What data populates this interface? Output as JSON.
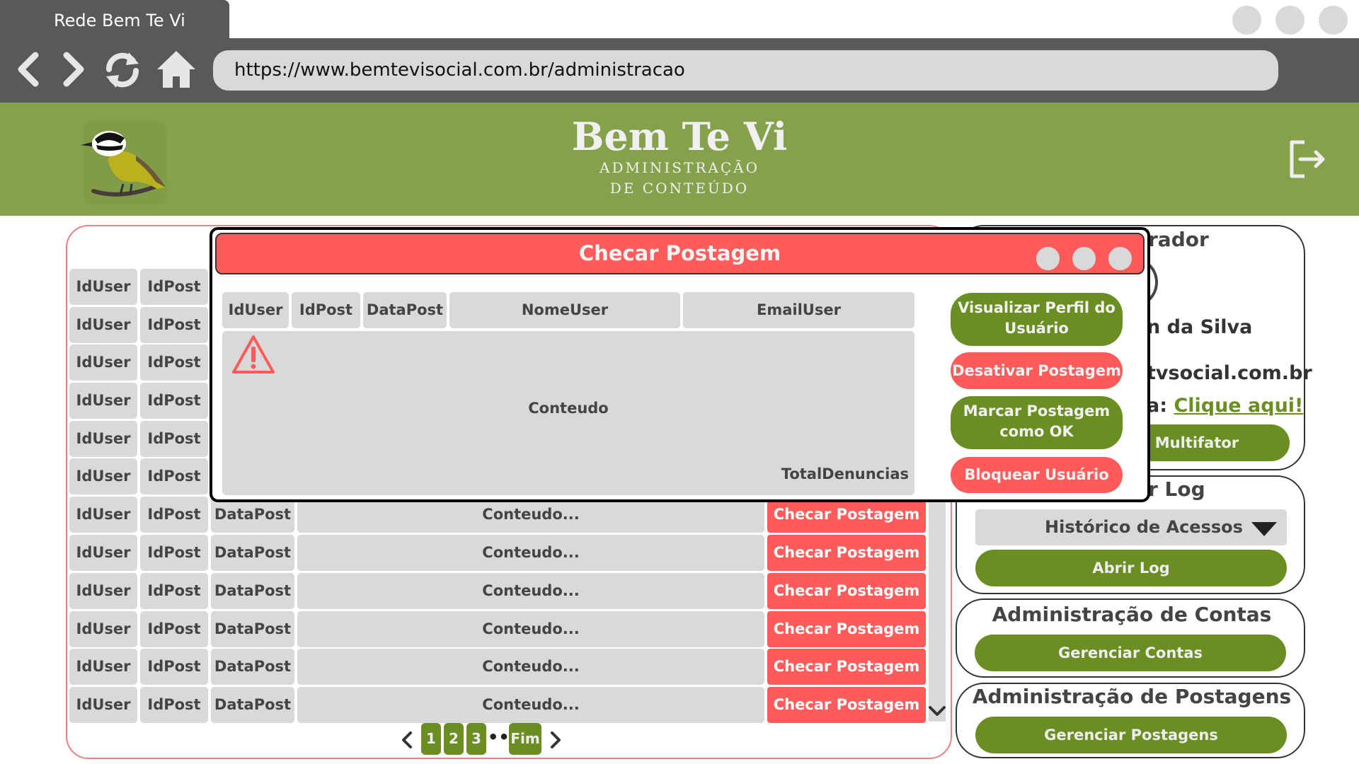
{
  "browser": {
    "tab_title": "Rede Bem Te Vi",
    "url": "https://www.bemtevisocial.com.br/administracao"
  },
  "banner": {
    "brand_name": "Bem Te Vi",
    "brand_subtitle": "ADMINISTRAÇÃO DE CONTEÚDO"
  },
  "table": {
    "rows": [
      {
        "iduser": "IdUser",
        "idpost": "IdPost"
      },
      {
        "iduser": "IdUser",
        "idpost": "IdPost"
      },
      {
        "iduser": "IdUser",
        "idpost": "IdPost"
      },
      {
        "iduser": "IdUser",
        "idpost": "IdPost"
      },
      {
        "iduser": "IdUser",
        "idpost": "IdPost"
      },
      {
        "iduser": "IdUser",
        "idpost": "IdPost"
      },
      {
        "iduser": "IdUser",
        "idpost": "IdPost",
        "datapost": "DataPost",
        "content": "Conteudo...",
        "action": "Checar Postagem"
      },
      {
        "iduser": "IdUser",
        "idpost": "IdPost",
        "datapost": "DataPost",
        "content": "Conteudo...",
        "action": "Checar Postagem"
      },
      {
        "iduser": "IdUser",
        "idpost": "IdPost",
        "datapost": "DataPost",
        "content": "Conteudo...",
        "action": "Checar Postagem"
      },
      {
        "iduser": "IdUser",
        "idpost": "IdPost",
        "datapost": "DataPost",
        "content": "Conteudo...",
        "action": "Checar Postagem"
      },
      {
        "iduser": "IdUser",
        "idpost": "IdPost",
        "datapost": "DataPost",
        "content": "Conteudo...",
        "action": "Checar Postagem"
      },
      {
        "iduser": "IdUser",
        "idpost": "IdPost",
        "datapost": "DataPost",
        "content": "Conteudo...",
        "action": "Checar Postagem"
      }
    ]
  },
  "pagination": {
    "pages": [
      "1",
      "2",
      "3"
    ],
    "ellipsis": "•••",
    "last": "Fim"
  },
  "admin_panel": {
    "title_fragment": "rador",
    "name_fragment": "n da Silva",
    "email_fragment": "tvsocial.com.br",
    "password_prefix": "a:",
    "password_link": "Clique aqui!",
    "mfa_button": "ão Multifator"
  },
  "log_panel": {
    "title_fragment": "r Log",
    "select_value": "Histórico de Acessos",
    "open_button": "Abrir Log"
  },
  "accounts_panel": {
    "title": "Administração de Contas",
    "button": "Gerenciar Contas"
  },
  "posts_panel": {
    "title": "Administração de Postagens",
    "button": "Gerenciar Postagens"
  },
  "modal": {
    "title": "Checar Postagem",
    "headers": [
      "IdUser",
      "IdPost",
      "DataPost",
      "NomeUser",
      "EmailUser"
    ],
    "content_label": "Conteudo",
    "total_label": "TotalDenuncias",
    "buttons": {
      "view_profile": "Visualizar Perfil do Usuário",
      "disable_post": "Desativar Postagem",
      "mark_ok": "Marcar Postagem como OK",
      "block_user": "Bloquear Usuário"
    }
  },
  "colors": {
    "browser_chrome": "#595959",
    "banner": "#85a14c",
    "accent_green": "#6b8e23",
    "accent_red": "#ff5b5b",
    "cell_gray": "#d9d9d9"
  }
}
